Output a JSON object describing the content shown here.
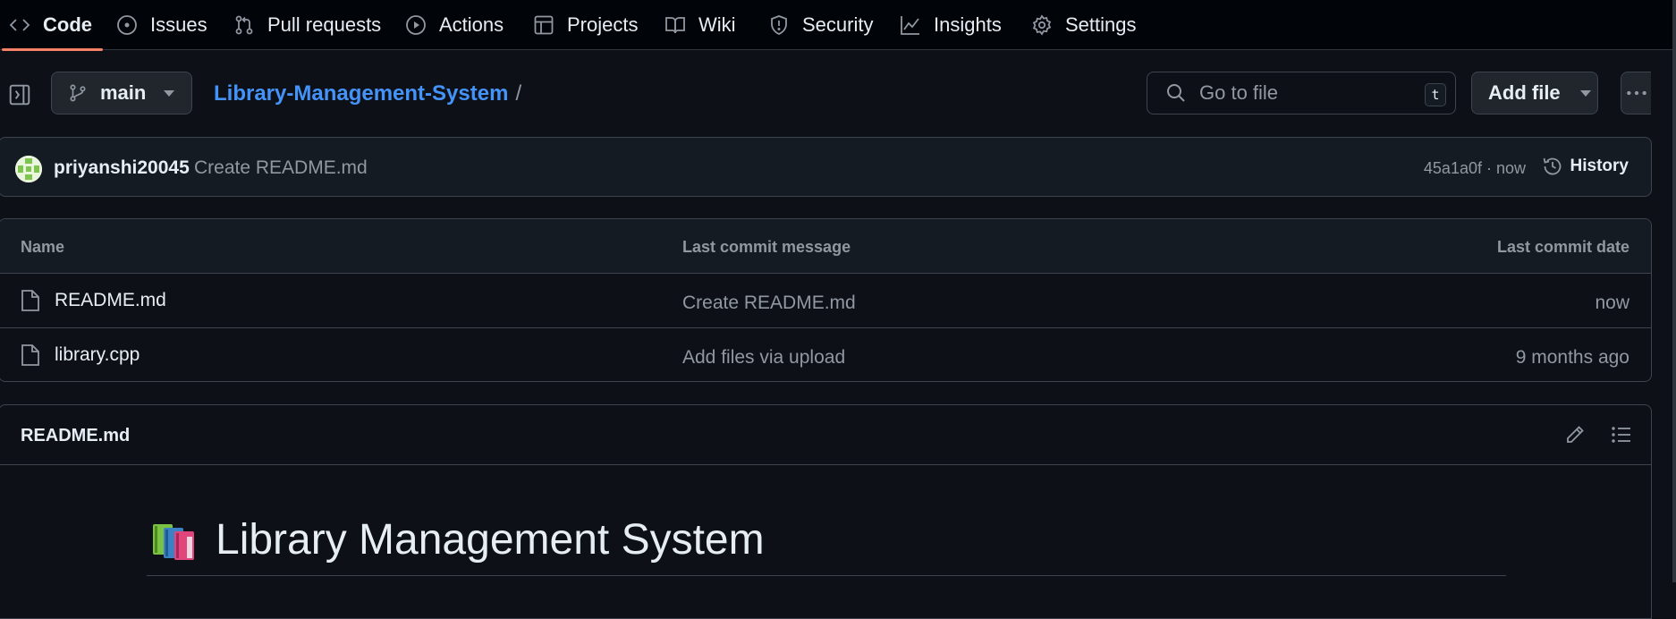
{
  "colors": {
    "background": "#0d1117",
    "border": "#3d444d",
    "link": "#4493f8",
    "active_tab_underline": "#f78166",
    "muted_text": "#9198a1"
  },
  "nav": {
    "tabs": [
      {
        "label": "Code",
        "icon": "code-icon",
        "active": true
      },
      {
        "label": "Issues",
        "icon": "issue-icon"
      },
      {
        "label": "Pull requests",
        "icon": "pull-request-icon"
      },
      {
        "label": "Actions",
        "icon": "play-icon"
      },
      {
        "label": "Projects",
        "icon": "table-icon"
      },
      {
        "label": "Wiki",
        "icon": "book-icon"
      },
      {
        "label": "Security",
        "icon": "shield-icon"
      },
      {
        "label": "Insights",
        "icon": "graph-icon"
      },
      {
        "label": "Settings",
        "icon": "gear-icon"
      }
    ]
  },
  "toolbar": {
    "branch": "main",
    "repo_name": "Library-Management-System",
    "path_separator": "/",
    "search_placeholder": "Go to file",
    "search_shortcut": "t",
    "add_file_label": "Add file"
  },
  "latest_commit": {
    "author": "priyanshi20045",
    "message": "Create README.md",
    "meta": "45a1a0f · now",
    "history_label": "History"
  },
  "file_table": {
    "headers": [
      "Name",
      "Last commit message",
      "Last commit date"
    ],
    "rows": [
      {
        "name": "README.md",
        "message": "Create README.md",
        "date": "now"
      },
      {
        "name": "library.cpp",
        "message": "Add files via upload",
        "date": "9 months ago"
      }
    ]
  },
  "readme": {
    "filename": "README.md",
    "heading": "Library Management System",
    "heading_icon": "books-emoji-icon"
  }
}
